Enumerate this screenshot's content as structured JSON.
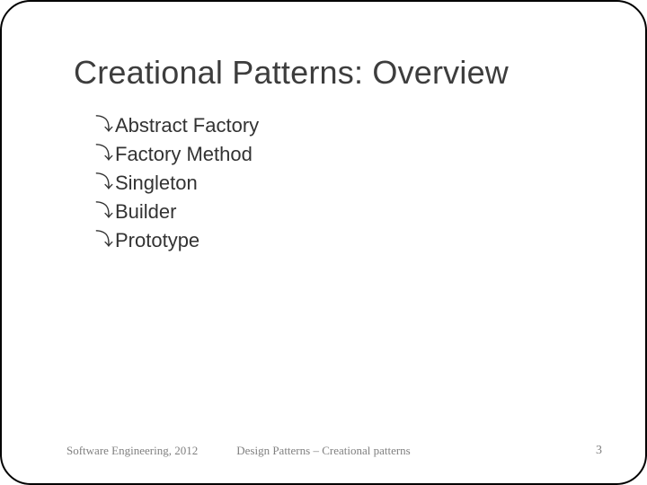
{
  "title": "Creational Patterns: Overview",
  "items": [
    "Abstract Factory",
    "Factory Method",
    "Singleton",
    "Builder",
    "Prototype"
  ],
  "footer": {
    "left": "Software Engineering, 2012",
    "center": "Design Patterns – Creational patterns",
    "right": "3"
  }
}
